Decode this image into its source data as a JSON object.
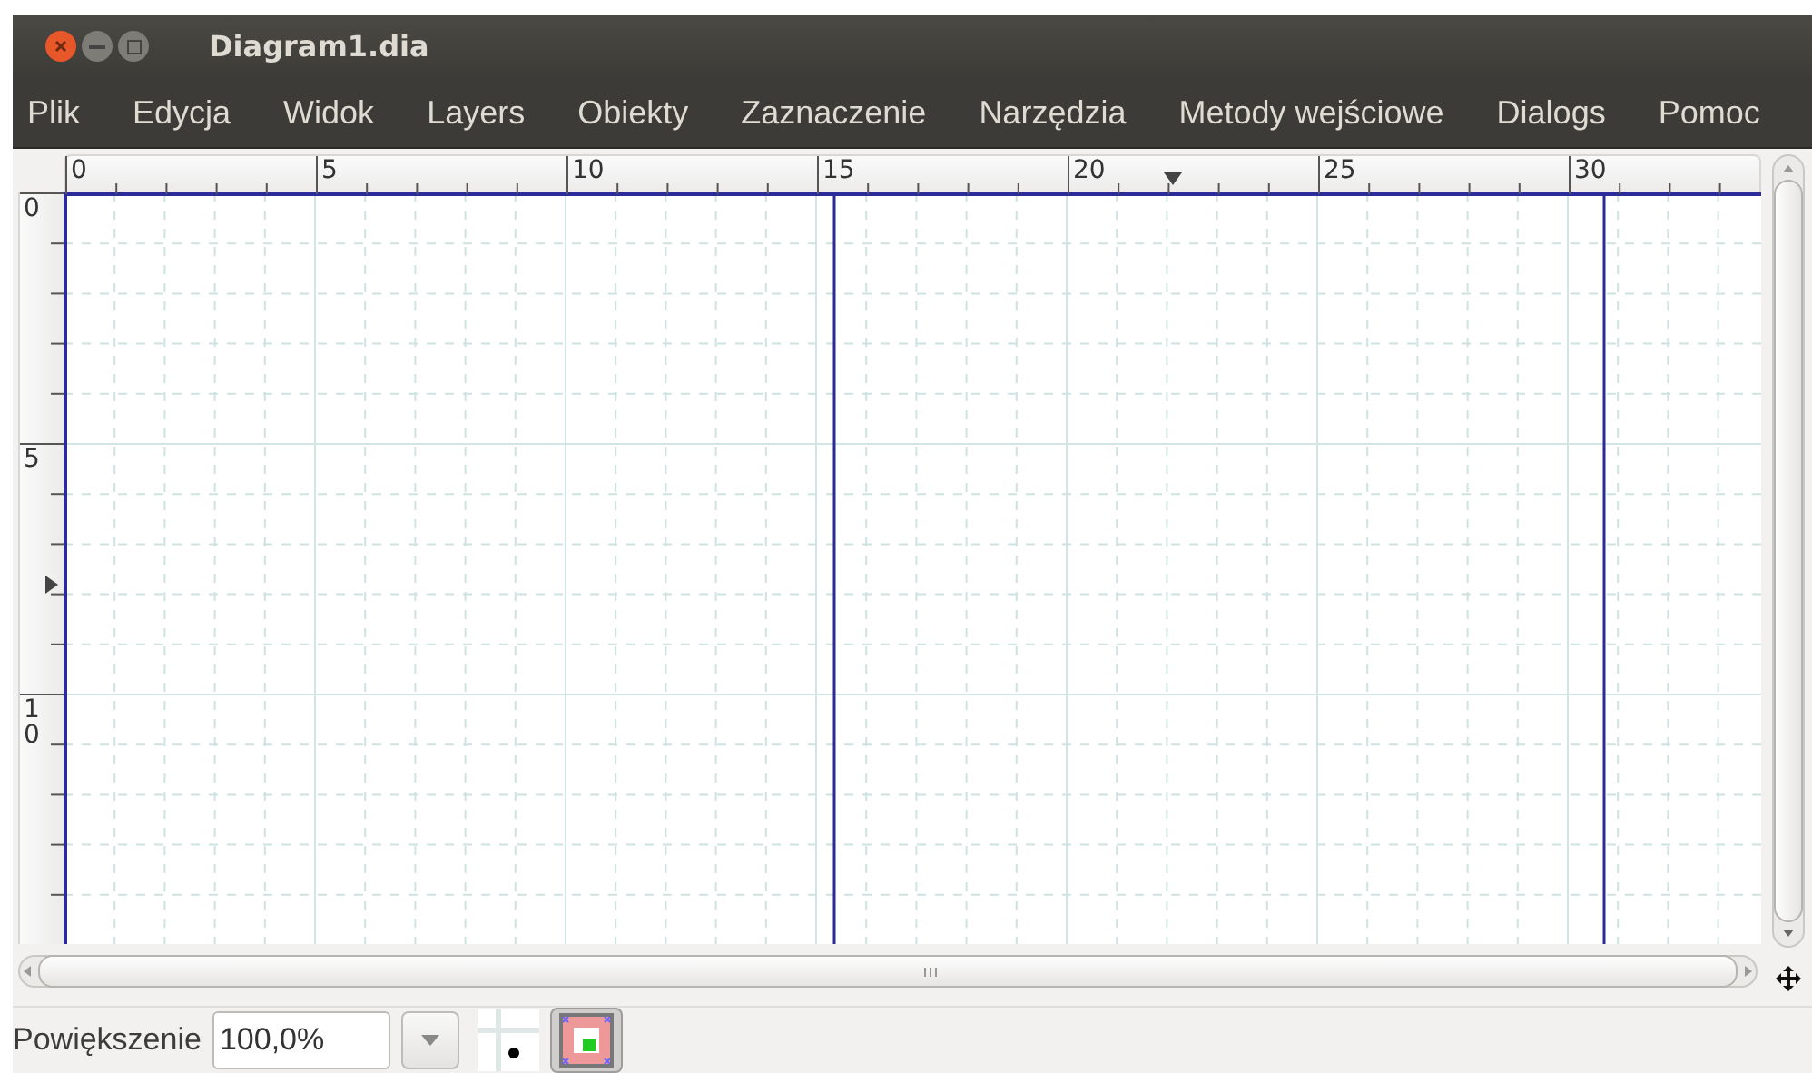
{
  "window": {
    "title": "Diagram1.dia"
  },
  "menu": [
    "Plik",
    "Edycja",
    "Widok",
    "Layers",
    "Obiekty",
    "Zaznaczenie",
    "Narzędzia",
    "Metody wejściowe",
    "Dialogs",
    "Pomoc"
  ],
  "horizontal_ruler": {
    "labels": [
      "0",
      "5",
      "10",
      "15",
      "20",
      "25",
      "30"
    ]
  },
  "vertical_ruler": {
    "labels": [
      "0",
      "5",
      "10"
    ]
  },
  "zoom": {
    "label": "Powiększenie",
    "value": "100,0%"
  }
}
